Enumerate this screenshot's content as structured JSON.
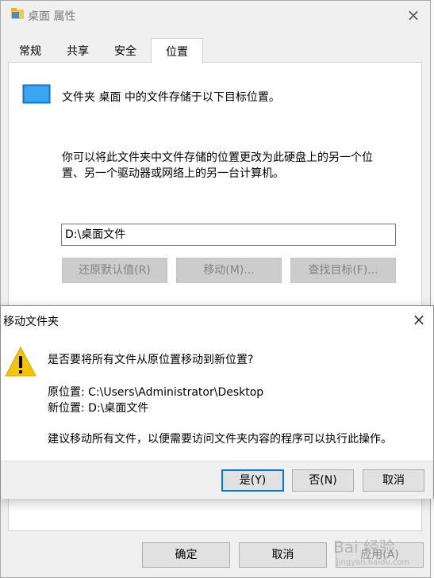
{
  "props": {
    "title": "桌面 属性",
    "close": "×",
    "tabs": {
      "general": "常规",
      "share": "共享",
      "security": "安全",
      "location": "位置"
    },
    "location_desc": "文件夹 桌面 中的文件存储于以下目标位置。",
    "explain_1": "你可以将此文件夹中文件存储的位置更改为此硬盘上的另一个位",
    "explain_2": "置、另一个驱动器或网络上的另一台计算机。",
    "path_value": "D:\\桌面文件",
    "buttons": {
      "restore": "还原默认值(R)",
      "move": "移动(M)...",
      "find": "查找目标(F)..."
    },
    "footer": {
      "ok": "确定",
      "cancel": "取消",
      "apply": "应用(A)"
    }
  },
  "dialog": {
    "title": "移动文件夹",
    "close": "×",
    "question": "是否要将所有文件从原位置移动到新位置?",
    "original_line": "原位置: C:\\Users\\Administrator\\Desktop",
    "new_line": "新位置: D:\\桌面文件",
    "advice": "建议移动所有文件，以便需要访问文件夹内容的程序可以执行此操作。",
    "buttons": {
      "yes": "是(Y)",
      "no": "否(N)",
      "cancel": "取消"
    }
  },
  "watermark": {
    "brand": "Bai 经验",
    "url": "jingyan.baidu.com"
  },
  "colors": {
    "accent": "#0078d7",
    "warning": "#f5c400",
    "disabled_button": "#cccccc"
  },
  "icons": {
    "folder": "folder-icon",
    "monitor": "monitor-icon",
    "warning": "warning-icon",
    "close": "close-icon"
  }
}
